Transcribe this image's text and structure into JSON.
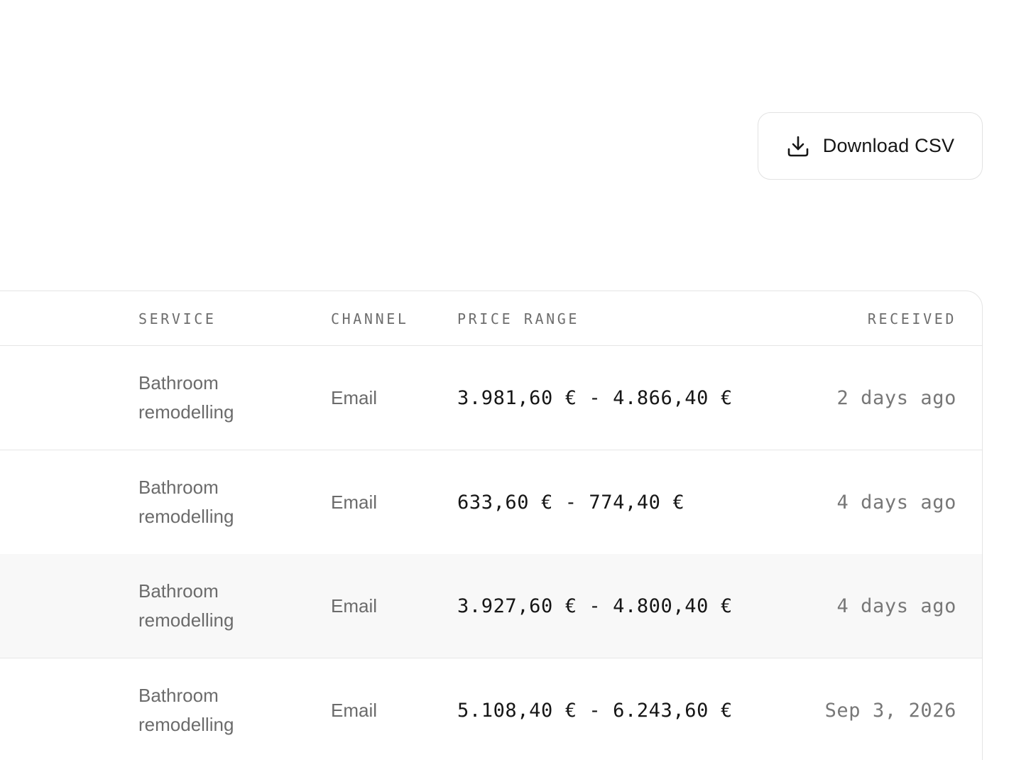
{
  "toolbar": {
    "download_label": "Download CSV",
    "download_icon": "download-icon"
  },
  "table": {
    "headers": {
      "service": "SERVICE",
      "channel": "CHANNEL",
      "price_range": "PRICE RANGE",
      "received": "RECEIVED"
    },
    "rows": [
      {
        "service_line1": "Bathroom",
        "service_line2": "remodelling",
        "channel": "Email",
        "price_range": "3.981,60 € - 4.866,40 €",
        "received": "2 days ago"
      },
      {
        "service_line1": "Bathroom",
        "service_line2": "remodelling",
        "channel": "Email",
        "price_range": "633,60 € - 774,40 €",
        "received": "4 days ago"
      },
      {
        "service_line1": "Bathroom",
        "service_line2": "remodelling",
        "channel": "Email",
        "price_range": "3.927,60 € - 4.800,40 €",
        "received": "4 days ago"
      },
      {
        "service_line1": "Bathroom",
        "service_line2": "remodelling",
        "channel": "Email",
        "price_range": "5.108,40 € - 6.243,60 €",
        "received": "Sep 3, 2026"
      }
    ]
  },
  "colors": {
    "border": "#e4e4e4",
    "highlight_row": "#f8f8f8",
    "muted_text": "#6b6b6b",
    "primary_text": "#161616"
  }
}
